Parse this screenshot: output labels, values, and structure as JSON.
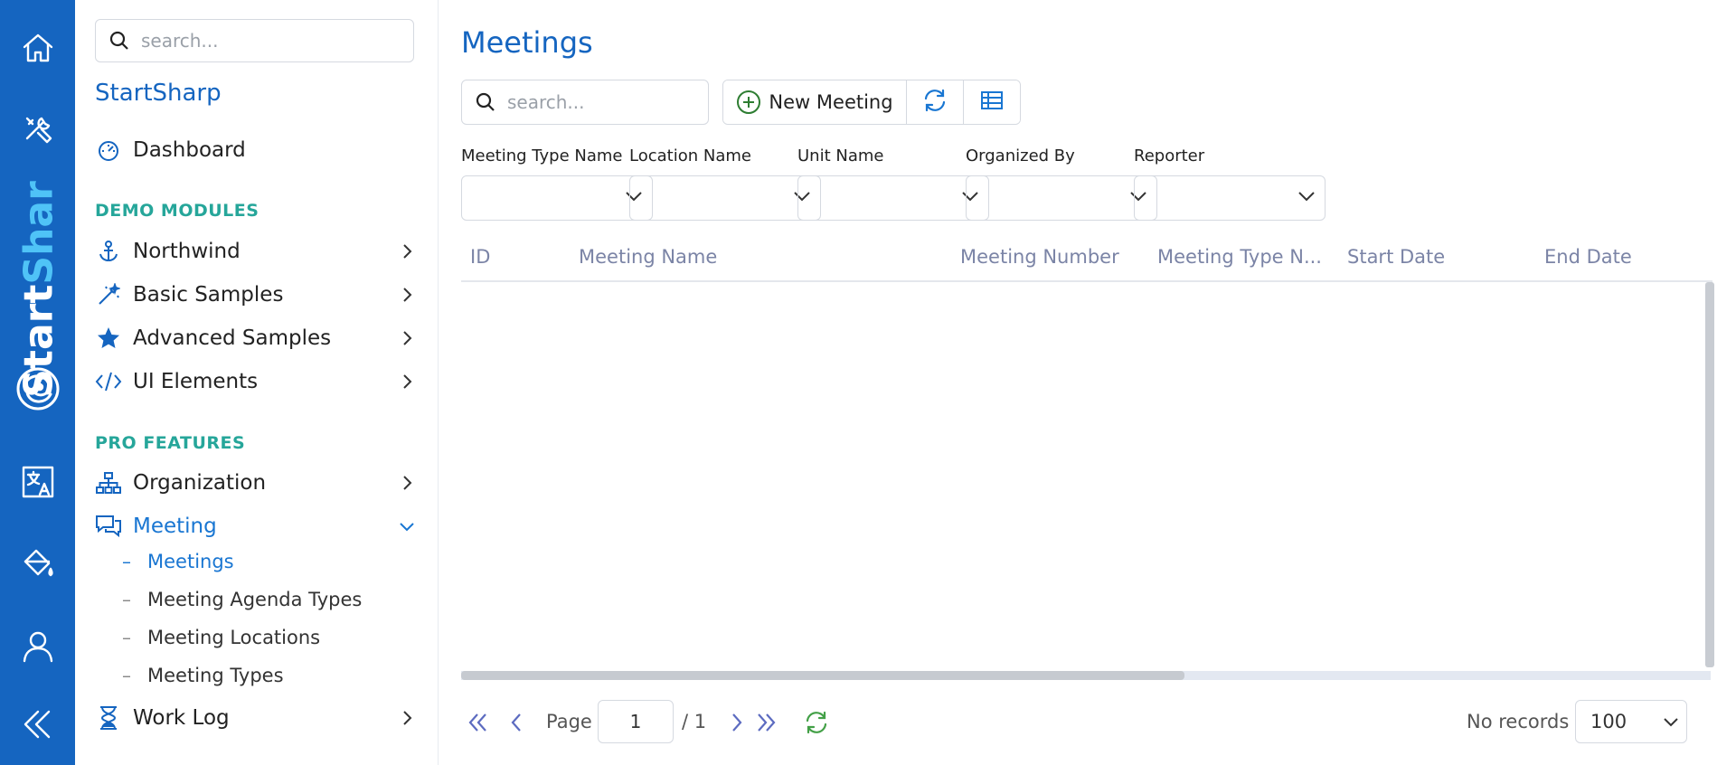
{
  "brand": {
    "part1": "Start",
    "part2": "Shar"
  },
  "sidebar": {
    "search_placeholder": "search...",
    "title": "StartSharp",
    "dashboard": "Dashboard",
    "section_demo": "DEMO MODULES",
    "northwind": "Northwind",
    "basic_samples": "Basic Samples",
    "advanced_samples": "Advanced Samples",
    "ui_elements": "UI Elements",
    "section_pro": "PRO FEATURES",
    "organization": "Organization",
    "meeting": "Meeting",
    "sub": [
      "Meetings",
      "Meeting Agenda Types",
      "Meeting Locations",
      "Meeting Types"
    ],
    "work_log": "Work Log"
  },
  "main": {
    "title": "Meetings",
    "search_placeholder": "search...",
    "new_button": "New Meeting",
    "filters": [
      "Meeting Type Name",
      "Location Name",
      "Unit Name",
      "Organized By",
      "Reporter"
    ],
    "columns": [
      "ID",
      "Meeting Name",
      "Meeting Number",
      "Meeting Type N...",
      "Start Date",
      "End Date"
    ]
  },
  "pager": {
    "page_label": "Page",
    "page_value": "1",
    "of_total": "/ 1",
    "status": "No records",
    "page_size": "100"
  },
  "colors": {
    "accent": "#1565c0",
    "section": "#26a69a",
    "new_icon": "#2e7d32"
  }
}
